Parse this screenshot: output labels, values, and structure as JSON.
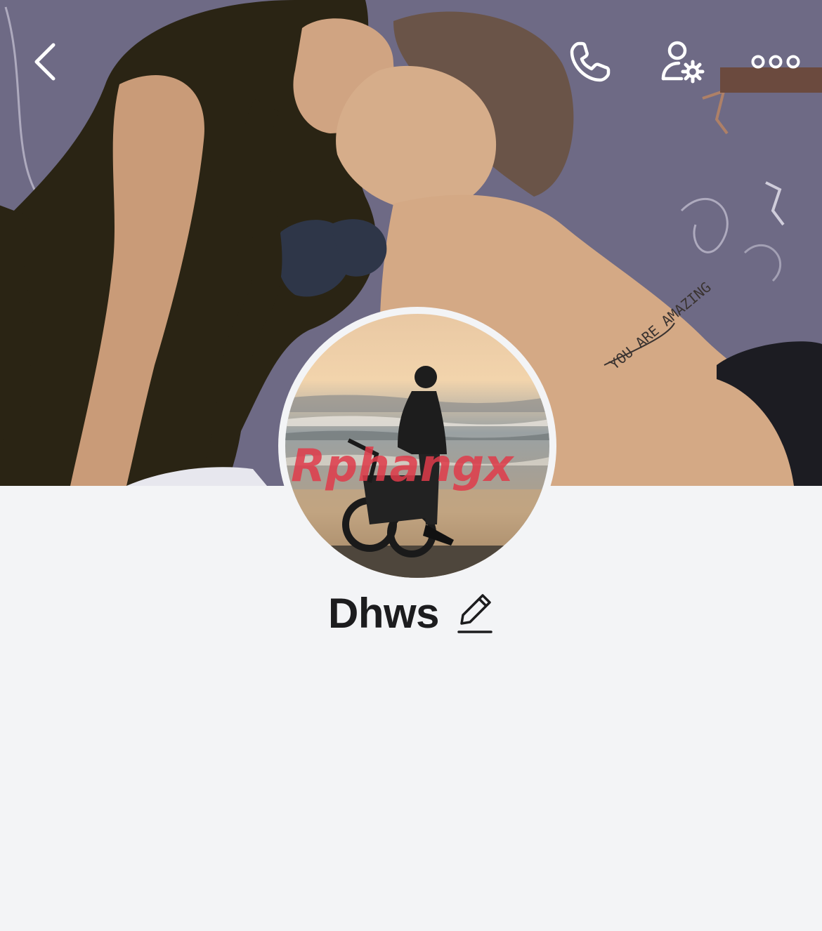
{
  "header": {
    "back_icon": "chevron-left-icon",
    "call_icon": "phone-icon",
    "settings_icon": "user-settings-icon",
    "more_icon": "more-horizontal-icon",
    "icon_color": "#ffffff"
  },
  "cover": {
    "background_color": "#6f6b86",
    "tattoo_text": "YOU ARE AMAZING"
  },
  "profile": {
    "name": "Dhws",
    "edit_icon": "pencil-edit-icon",
    "avatar_watermark": "Rphangx"
  },
  "colors": {
    "page_background": "#f3f4f6",
    "name_text": "#1c1c1e"
  }
}
